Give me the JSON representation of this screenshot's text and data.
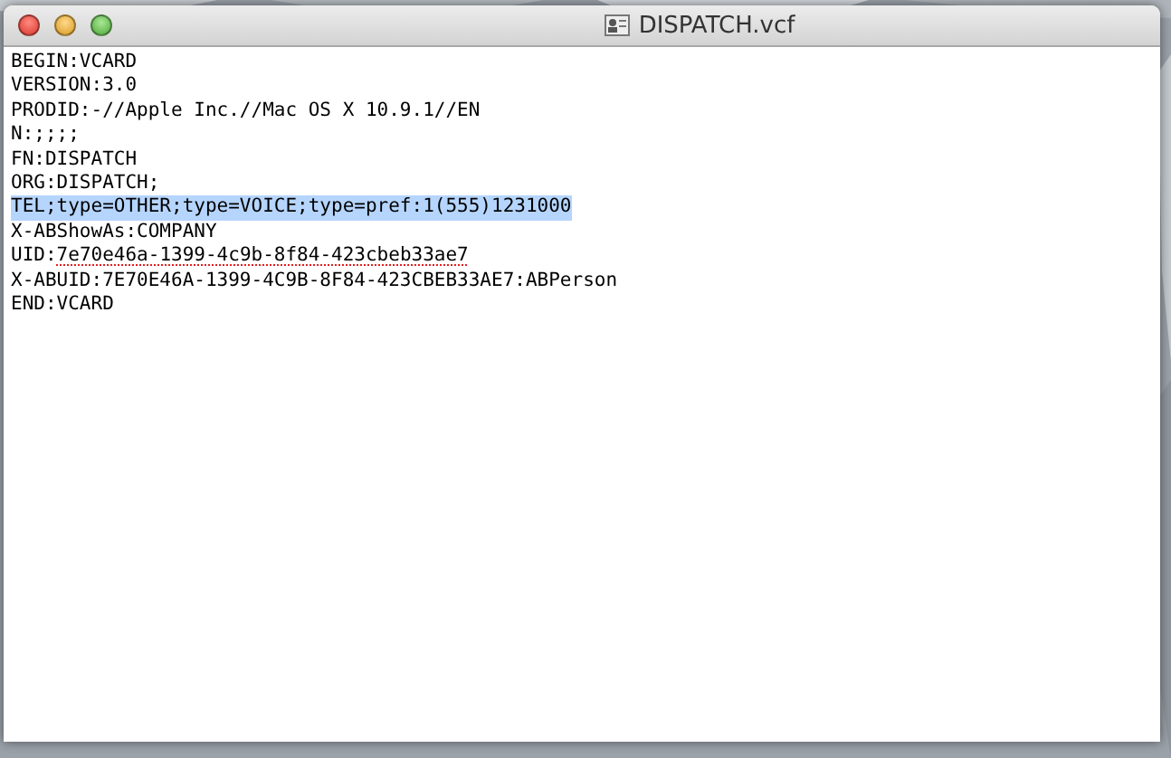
{
  "window": {
    "title": "DISPATCH.vcf"
  },
  "lines": [
    {
      "text": "BEGIN:VCARD",
      "selected": false
    },
    {
      "text": "VERSION:3.0",
      "selected": false
    },
    {
      "text": "PRODID:-//Apple Inc.//Mac OS X 10.9.1//EN",
      "selected": false
    },
    {
      "text": "N:;;;;",
      "selected": false
    },
    {
      "text": "FN:DISPATCH",
      "selected": false
    },
    {
      "text": "ORG:DISPATCH;",
      "selected": false
    },
    {
      "text": "TEL;type=OTHER;type=VOICE;type=pref:1(555)1231000",
      "selected": true
    },
    {
      "text": "X-ABShowAs:COMPANY",
      "selected": false
    },
    {
      "text": "UID:",
      "misspelled": "7e70e46a-1399-4c9b-8f84-423cbeb33ae7",
      "selected": false
    },
    {
      "text": "X-ABUID:7E70E46A-1399-4C9B-8F84-423CBEB33AE7:ABPerson",
      "selected": false
    },
    {
      "text": "END:VCARD",
      "selected": false
    }
  ]
}
